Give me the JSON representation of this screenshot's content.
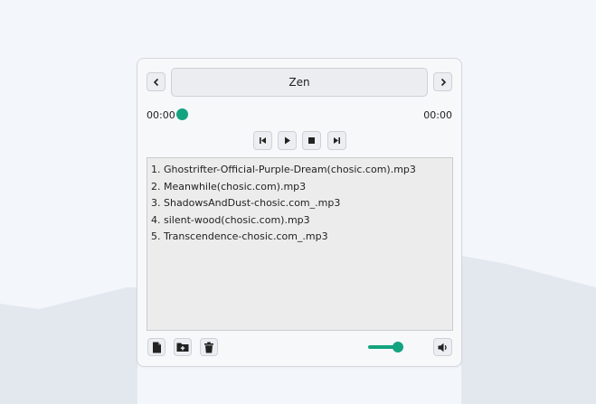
{
  "header": {
    "title": "Zen"
  },
  "progress": {
    "current_time": "00:00",
    "total_time": "00:00",
    "fraction": 0
  },
  "playlist": {
    "items": [
      "1. Ghostrifter-Official-Purple-Dream(chosic.com).mp3",
      "2. Meanwhile(chosic.com).mp3",
      "3. ShadowsAndDust-chosic.com_.mp3",
      "4. silent-wood(chosic.com).mp3",
      "5. Transcendence-chosic.com_.mp3"
    ]
  },
  "volume": {
    "fraction": 1.0
  },
  "icons": {
    "prev_nav": "chevron-left-icon",
    "next_nav": "chevron-right-icon",
    "skip_back": "skip-back-icon",
    "play": "play-icon",
    "stop": "stop-icon",
    "skip_forward": "skip-forward-icon",
    "add_file": "file-icon",
    "add_folder": "folder-add-icon",
    "delete": "trash-icon",
    "speaker": "speaker-icon"
  },
  "colors": {
    "accent": "#14a37f",
    "background": "#f3f6fa",
    "panel": "#f7f8fa"
  }
}
